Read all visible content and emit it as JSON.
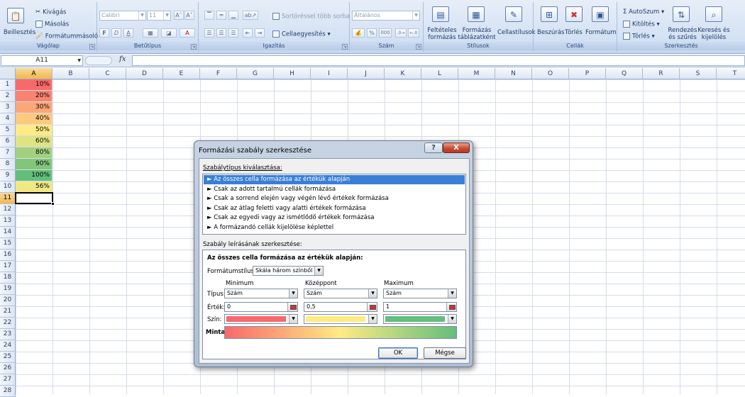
{
  "ribbon": {
    "clipboard": {
      "paste": "Beillesztés",
      "cut": "Kivágás",
      "copy": "Másolás",
      "format_painter": "Formátummásoló",
      "label": "Vágólap"
    },
    "font": {
      "name": "Calibri",
      "size": "11",
      "label": "Betűtípus",
      "bold": "F",
      "italic": "D",
      "underline": "A",
      "grow": "A˄",
      "shrink": "A˅"
    },
    "alignment": {
      "wrap": "Sortöréssel több sorba",
      "merge": "Cellaegyesítés",
      "label": "Igazítás"
    },
    "number": {
      "format": "Általános",
      "percent": "%",
      "thousands": "000",
      "label": "Szám"
    },
    "styles": {
      "conditional": "Feltételes formázás",
      "table": "Formázás táblázatként",
      "cell": "Cellastílusok",
      "label": "Stílusok"
    },
    "cells": {
      "insert": "Beszúrás",
      "delete": "Törlés",
      "format": "Formátum",
      "label": "Cellák"
    },
    "editing": {
      "autosum": "AutoSzum",
      "fill": "Kitöltés",
      "clear": "Törlés",
      "sort": "Rendezés és szűrés",
      "find": "Keresés és kijelölés",
      "label": "Szerkesztés"
    }
  },
  "formula_bar": {
    "name_box": "A11",
    "fx": "fx",
    "value": ""
  },
  "sheet": {
    "columns": [
      "A",
      "B",
      "C",
      "D",
      "E",
      "F",
      "G",
      "H",
      "I",
      "J",
      "K",
      "L",
      "M",
      "N",
      "O",
      "P",
      "Q",
      "R",
      "S",
      "T"
    ],
    "selected_column": "A",
    "rows": [
      "1",
      "2",
      "3",
      "4",
      "5",
      "6",
      "7",
      "8",
      "9",
      "10",
      "11",
      "12",
      "13",
      "14",
      "15",
      "16",
      "17",
      "18",
      "19",
      "20",
      "21",
      "22",
      "23",
      "24",
      "25",
      "26",
      "27",
      "28"
    ],
    "selected_row": "11",
    "cells_a": [
      {
        "value": "10%",
        "color": "#f8696b"
      },
      {
        "value": "20%",
        "color": "#f98370"
      },
      {
        "value": "30%",
        "color": "#fba777"
      },
      {
        "value": "40%",
        "color": "#fdc97d"
      },
      {
        "value": "50%",
        "color": "#ffeb84"
      },
      {
        "value": "60%",
        "color": "#e0e383"
      },
      {
        "value": "80%",
        "color": "#a2d07f"
      },
      {
        "value": "90%",
        "color": "#82c67c"
      },
      {
        "value": "100%",
        "color": "#63be7b"
      },
      {
        "value": "56%",
        "color": "#f1e884"
      }
    ]
  },
  "dialog": {
    "title": "Formázási szabály szerkesztése",
    "help": "?",
    "close": "X",
    "rule_type_label": "Szabálytípus kiválasztása:",
    "rule_types": [
      "► Az összes cella formázása az értékük alapján",
      "► Csak az adott tartalmú cellák formázása",
      "► Csak a sorrend elején vagy végén lévő értékek formázása",
      "► Csak az átlag feletti vagy alatti értékek formázása",
      "► Csak az egyedi vagy az ismétlődő értékek formázása",
      "► A formázandó cellák kijelölése képlettel"
    ],
    "edit_label": "Szabály leírásának szerkesztése:",
    "desc_title": "Az összes cella formázása az értékük alapján:",
    "format_style_label": "Formátumstílus:",
    "format_style_value": "Skála három színből",
    "columns": {
      "min": "Minimum",
      "mid": "Középpont",
      "max": "Maximum"
    },
    "type_label": "Típus:",
    "value_label": "Érték:",
    "color_label": "Szín:",
    "types": {
      "min": "Szám",
      "mid": "Szám",
      "max": "Szám"
    },
    "values": {
      "min": "0",
      "mid": "0,5",
      "max": "1"
    },
    "colors": {
      "min": "#f8696b",
      "mid": "#ffeb84",
      "max": "#63be7b"
    },
    "sample_label": "Minta:",
    "ok": "OK",
    "cancel": "Mégse"
  }
}
